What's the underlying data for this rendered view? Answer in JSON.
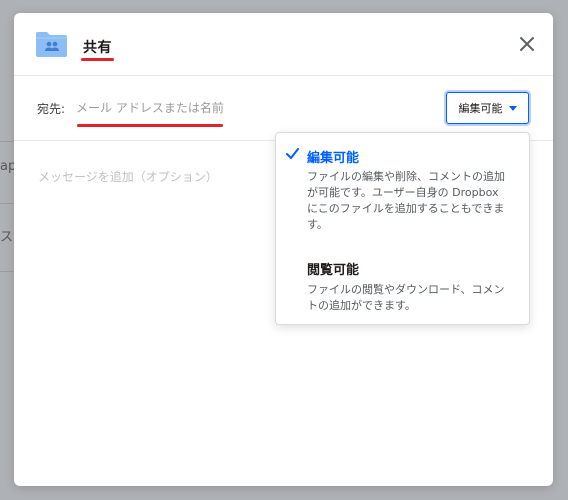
{
  "background": {
    "fragments": [
      "ap",
      "スタ"
    ]
  },
  "dialog": {
    "title": "共有",
    "close_icon": "close-icon",
    "folder_icon": "shared-folder-icon"
  },
  "to": {
    "label": "宛先:",
    "placeholder": "メール アドレスまたは名前",
    "value": ""
  },
  "permission": {
    "selected": "編集可能"
  },
  "message": {
    "placeholder": "メッセージを追加（オプション）"
  },
  "dropdown": {
    "options": [
      {
        "title": "編集可能",
        "description": "ファイルの編集や削除、コメントの追加が可能です。ユーザー自身の Dropbox にこのファイルを追加することもできます。",
        "selected": true
      },
      {
        "title": "閲覧可能",
        "description": "ファイルの閲覧やダウンロード、コメントの追加ができます。",
        "selected": false
      }
    ]
  },
  "colors": {
    "accent": "#0061fe",
    "annotation": "#e0242b",
    "folder": "#8dbdf5"
  }
}
